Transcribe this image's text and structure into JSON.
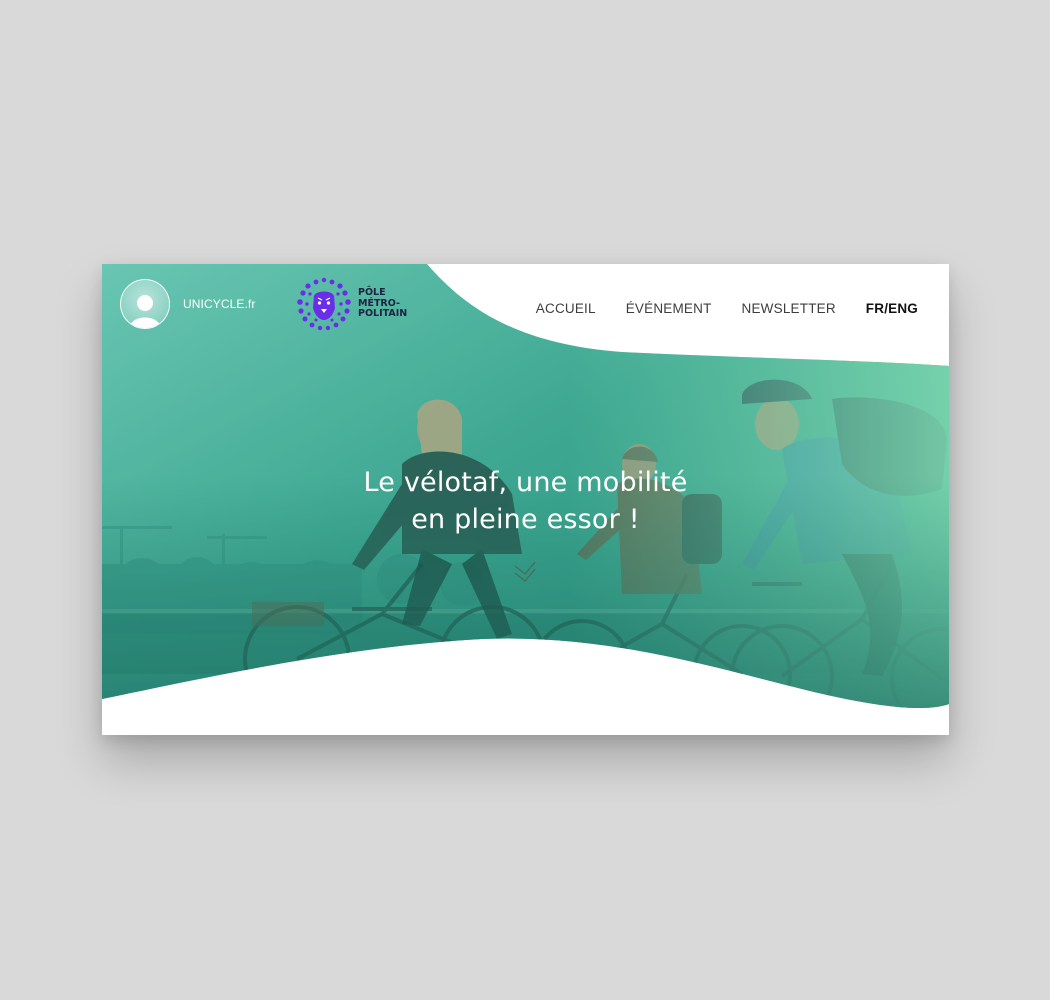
{
  "brand": {
    "avatar_icon": "user-avatar-icon",
    "name": "UNICYCLE.fr"
  },
  "partner": {
    "logo_icon": "lion-dots-icon",
    "line1": "PÔLE",
    "line2": "MÉTRO-",
    "line3": "POLITAIN"
  },
  "nav": {
    "items": [
      "ACCUEIL",
      "ÉVÉNEMENT",
      "NEWSLETTER"
    ],
    "lang": "FR/ENG"
  },
  "hero": {
    "headline_line1": "Le vélotaf, une mobilité",
    "headline_line2": "en pleine essor !",
    "scroll_icon": "double-chevron-down-icon",
    "overlay_colors": [
      "#8ce3b7",
      "#1f8a78"
    ],
    "photo_subject": "cyclists-commuting-photo"
  },
  "colors": {
    "page_background": "#d9d9d9",
    "card_background": "#ffffff",
    "accent_purple": "#6a2ee8",
    "teal_dark": "#1f8a78"
  }
}
